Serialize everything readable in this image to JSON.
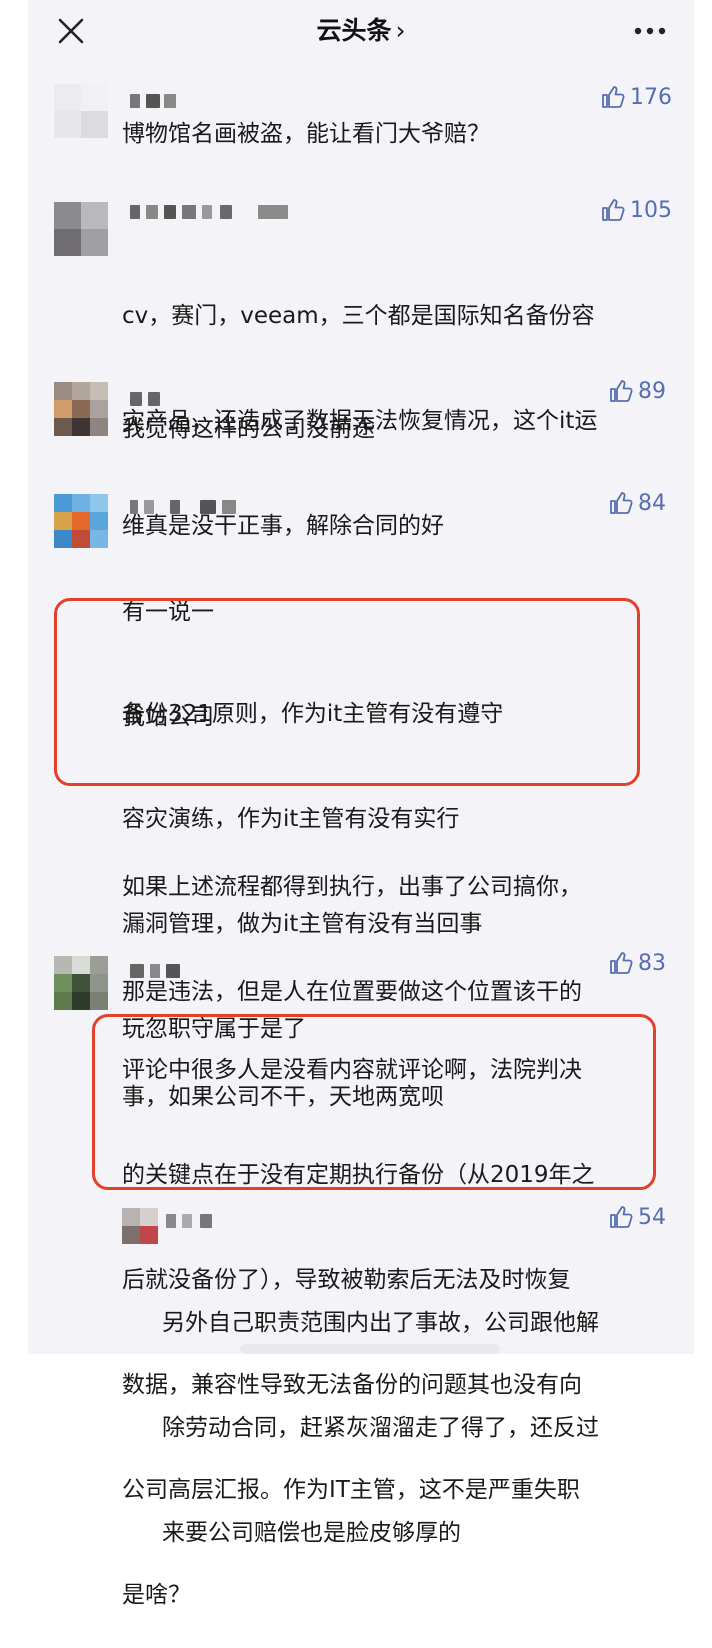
{
  "header": {
    "title": "云头条",
    "title_chevron": "›",
    "close_icon": "close-icon",
    "more_icon": "more-dots-icon"
  },
  "colors": {
    "accent_like": "#566eb2",
    "highlight_box": "#e3402a",
    "background": "#f4f3f7"
  },
  "comments": [
    {
      "likes": "176",
      "text": "博物馆名画被盗，能让看门大爷赔？"
    },
    {
      "likes": "105",
      "text": "cv，赛门，veeam，三个都是国际知名备份容灾产品，还造成了数据无法恢复情况，这个it运维真是没干正事，解除合同的好",
      "lines": [
        "cv，赛门，veeam，三个都是国际知名备份容",
        "灾产品，还造成了数据无法恢复情况，这个it运",
        "维真是没干正事，解除合同的好"
      ]
    },
    {
      "likes": "89",
      "text": "我觉得这样的公司没前途"
    },
    {
      "likes": "84",
      "lines_a": [
        "有一说一",
        "我站公司"
      ],
      "lines_box": [
        "备份321原则，作为it主管有没有遵守",
        "容灾演练，作为it主管有没有实行",
        "漏洞管理，做为it主管有没有当回事",
        "玩忽职守属于是了"
      ],
      "lines_b": [
        "如果上述流程都得到执行，出事了公司搞你，",
        "那是违法，但是人在位置要做这个位置该干的",
        "事，如果公司不干，天地两宽呗"
      ]
    },
    {
      "likes": "83",
      "lines": [
        "评论中很多人是没看内容就评论啊，法院判决",
        "的关键点在于没有定期执行备份（从2019年之",
        "后就没备份了），导致被勒索后无法及时恢复",
        "数据，兼容性导致无法备份的问题其也没有向",
        "公司高层汇报。作为IT主管，这不是严重失职",
        "是啥？"
      ]
    },
    {
      "likes": "54",
      "lines": [
        "另外自己职责范围内出了事故，公司跟他解",
        "除劳动合同，赶紧灰溜溜走了得了，还反过",
        "来要公司赔偿也是脸皮够厚的"
      ]
    }
  ]
}
